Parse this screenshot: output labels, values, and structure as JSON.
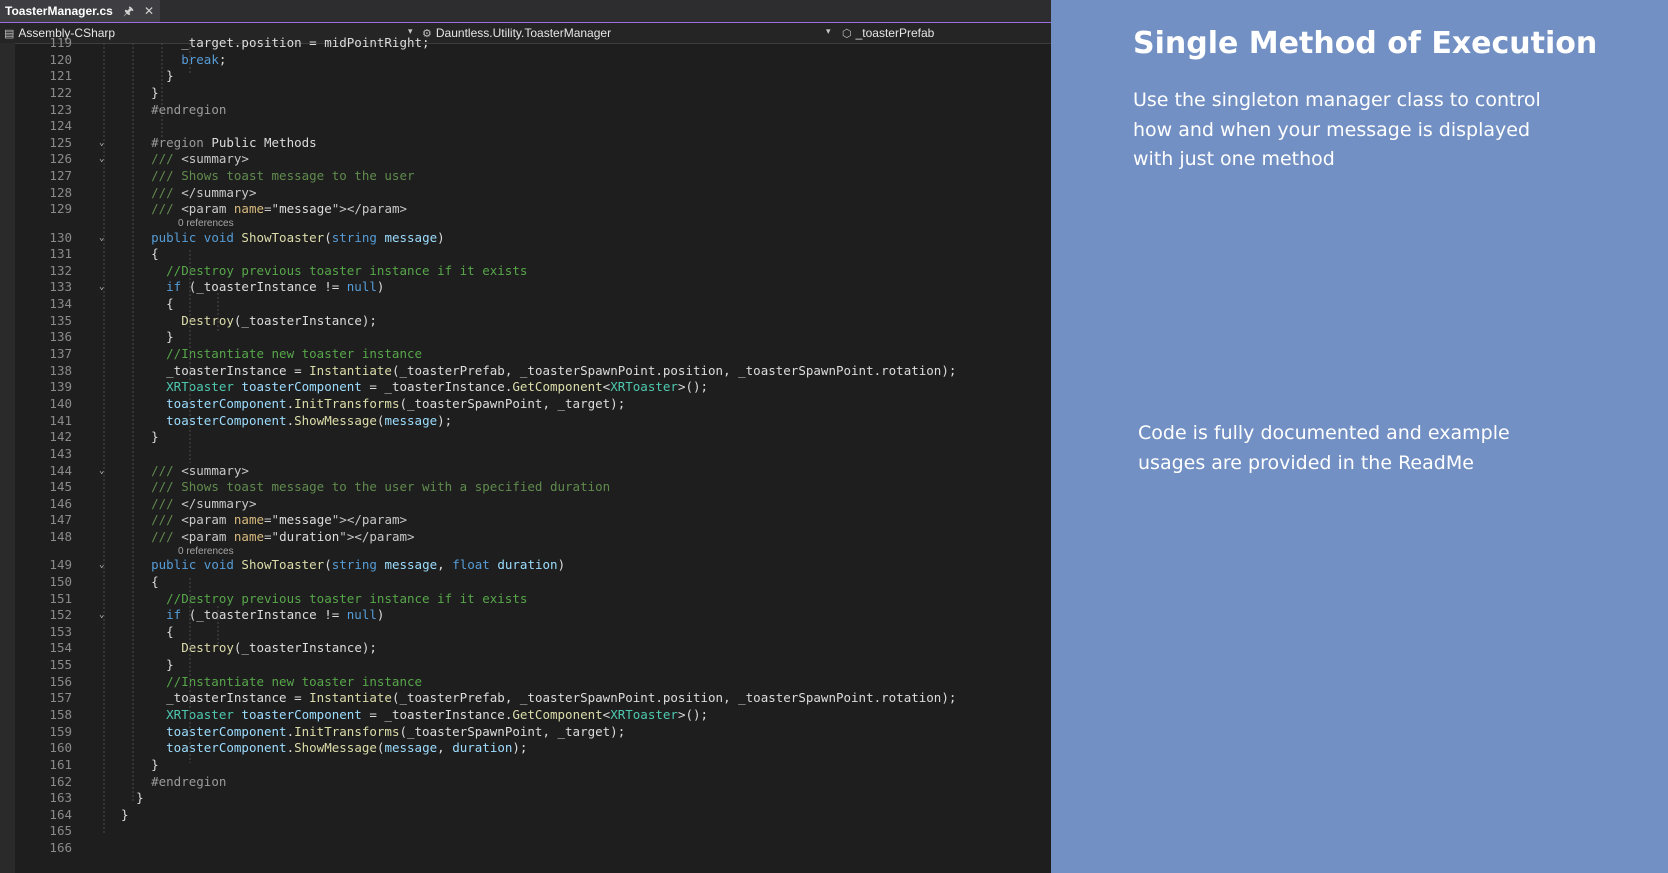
{
  "tab": {
    "title": "ToasterManager.cs",
    "pin_icon": "pin-icon",
    "close_icon": "close-icon"
  },
  "navbar": {
    "project": "Assembly-CSharp",
    "type": "Dauntless.Utility.ToasterManager",
    "member": "_toasterPrefab"
  },
  "code_lens_label": "0 references",
  "code_lines": [
    {
      "n": "119",
      "fold": false,
      "indent": 8,
      "s": [
        [
          "pl",
          "_target.position = midPointRight;"
        ]
      ]
    },
    {
      "n": "120",
      "fold": false,
      "indent": 8,
      "s": [
        [
          "kw",
          "break"
        ],
        [
          "pl",
          ";"
        ]
      ]
    },
    {
      "n": "121",
      "fold": false,
      "indent": 6,
      "s": [
        [
          "pl",
          "}"
        ]
      ]
    },
    {
      "n": "122",
      "fold": false,
      "indent": 4,
      "s": [
        [
          "pl",
          "}"
        ]
      ]
    },
    {
      "n": "123",
      "fold": false,
      "indent": 4,
      "s": [
        [
          "pp",
          "#endregion"
        ]
      ]
    },
    {
      "n": "124",
      "fold": false,
      "indent": 0,
      "s": []
    },
    {
      "n": "125",
      "fold": true,
      "indent": 4,
      "s": [
        [
          "pp",
          "#region "
        ],
        [
          "pl",
          "Public Methods"
        ]
      ]
    },
    {
      "n": "126",
      "fold": true,
      "indent": 4,
      "s": [
        [
          "xd",
          "/// "
        ],
        [
          "xa",
          "<summary>"
        ]
      ]
    },
    {
      "n": "127",
      "fold": false,
      "indent": 4,
      "s": [
        [
          "xd",
          "/// Shows toast message to the user"
        ]
      ]
    },
    {
      "n": "128",
      "fold": false,
      "indent": 4,
      "s": [
        [
          "xd",
          "/// "
        ],
        [
          "xa",
          "</summary>"
        ]
      ]
    },
    {
      "n": "129",
      "fold": false,
      "indent": 4,
      "s": [
        [
          "xd",
          "/// "
        ],
        [
          "xa",
          "<param "
        ],
        [
          "xs",
          "name"
        ],
        [
          "xa",
          "=\""
        ],
        [
          "pl",
          "message"
        ],
        [
          "xa",
          "\"></param>"
        ]
      ]
    },
    {
      "n": "",
      "lens": true
    },
    {
      "n": "130",
      "fold": true,
      "indent": 4,
      "s": [
        [
          "kw",
          "public void "
        ],
        [
          "fn",
          "ShowToaster"
        ],
        [
          "pl",
          "("
        ],
        [
          "kw",
          "string "
        ],
        [
          "pa",
          "message"
        ],
        [
          "pl",
          ")"
        ]
      ]
    },
    {
      "n": "131",
      "fold": false,
      "indent": 4,
      "s": [
        [
          "pl",
          "{"
        ]
      ]
    },
    {
      "n": "132",
      "fold": false,
      "indent": 6,
      "s": [
        [
          "cm",
          "//Destroy previous toaster instance if it exists"
        ]
      ]
    },
    {
      "n": "133",
      "fold": true,
      "indent": 6,
      "s": [
        [
          "kw",
          "if "
        ],
        [
          "pl",
          "(_toasterInstance != "
        ],
        [
          "kw",
          "null"
        ],
        [
          "pl",
          ")"
        ]
      ]
    },
    {
      "n": "134",
      "fold": false,
      "indent": 6,
      "s": [
        [
          "pl",
          "{"
        ]
      ]
    },
    {
      "n": "135",
      "fold": false,
      "indent": 8,
      "s": [
        [
          "fn",
          "Destroy"
        ],
        [
          "pl",
          "(_toasterInstance);"
        ]
      ]
    },
    {
      "n": "136",
      "fold": false,
      "indent": 6,
      "s": [
        [
          "pl",
          "}"
        ]
      ]
    },
    {
      "n": "137",
      "fold": false,
      "indent": 6,
      "s": [
        [
          "cm",
          "//Instantiate new toaster instance"
        ]
      ]
    },
    {
      "n": "138",
      "fold": false,
      "indent": 6,
      "s": [
        [
          "pl",
          "_toasterInstance = "
        ],
        [
          "fn",
          "Instantiate"
        ],
        [
          "pl",
          "(_toasterPrefab, _toasterSpawnPoint.position, _toasterSpawnPoint.rotation);"
        ]
      ]
    },
    {
      "n": "139",
      "fold": false,
      "indent": 6,
      "s": [
        [
          "ty",
          "XRToaster "
        ],
        [
          "pa",
          "toasterComponent"
        ],
        [
          "pl",
          " = _toasterInstance."
        ],
        [
          "fn",
          "GetComponent"
        ],
        [
          "pl",
          "<"
        ],
        [
          "ty",
          "XRToaster"
        ],
        [
          "pl",
          ">();"
        ]
      ]
    },
    {
      "n": "140",
      "fold": false,
      "indent": 6,
      "s": [
        [
          "pa",
          "toasterComponent"
        ],
        [
          "pl",
          "."
        ],
        [
          "fn",
          "InitTransforms"
        ],
        [
          "pl",
          "(_toasterSpawnPoint, _target);"
        ]
      ]
    },
    {
      "n": "141",
      "fold": false,
      "indent": 6,
      "s": [
        [
          "pa",
          "toasterComponent"
        ],
        [
          "pl",
          "."
        ],
        [
          "fn",
          "ShowMessage"
        ],
        [
          "pl",
          "("
        ],
        [
          "pa",
          "message"
        ],
        [
          "pl",
          ");"
        ]
      ]
    },
    {
      "n": "142",
      "fold": false,
      "indent": 4,
      "s": [
        [
          "pl",
          "}"
        ]
      ]
    },
    {
      "n": "143",
      "fold": false,
      "indent": 0,
      "s": []
    },
    {
      "n": "144",
      "fold": true,
      "indent": 4,
      "s": [
        [
          "xd",
          "/// "
        ],
        [
          "xa",
          "<summary>"
        ]
      ]
    },
    {
      "n": "145",
      "fold": false,
      "indent": 4,
      "s": [
        [
          "xd",
          "/// Shows toast message to the user with a specified duration"
        ]
      ]
    },
    {
      "n": "146",
      "fold": false,
      "indent": 4,
      "s": [
        [
          "xd",
          "/// "
        ],
        [
          "xa",
          "</summary>"
        ]
      ]
    },
    {
      "n": "147",
      "fold": false,
      "indent": 4,
      "s": [
        [
          "xd",
          "/// "
        ],
        [
          "xa",
          "<param "
        ],
        [
          "xs",
          "name"
        ],
        [
          "xa",
          "=\""
        ],
        [
          "pl",
          "message"
        ],
        [
          "xa",
          "\"></param>"
        ]
      ]
    },
    {
      "n": "148",
      "fold": false,
      "indent": 4,
      "s": [
        [
          "xd",
          "/// "
        ],
        [
          "xa",
          "<param "
        ],
        [
          "xs",
          "name"
        ],
        [
          "xa",
          "=\""
        ],
        [
          "pl",
          "duration"
        ],
        [
          "xa",
          "\"></param>"
        ]
      ]
    },
    {
      "n": "",
      "lens": true
    },
    {
      "n": "149",
      "fold": true,
      "indent": 4,
      "s": [
        [
          "kw",
          "public void "
        ],
        [
          "fn",
          "ShowToaster"
        ],
        [
          "pl",
          "("
        ],
        [
          "kw",
          "string "
        ],
        [
          "pa",
          "message"
        ],
        [
          "pl",
          ", "
        ],
        [
          "kw",
          "float "
        ],
        [
          "pa",
          "duration"
        ],
        [
          "pl",
          ")"
        ]
      ]
    },
    {
      "n": "150",
      "fold": false,
      "indent": 4,
      "s": [
        [
          "pl",
          "{"
        ]
      ]
    },
    {
      "n": "151",
      "fold": false,
      "indent": 6,
      "s": [
        [
          "cm",
          "//Destroy previous toaster instance if it exists"
        ]
      ]
    },
    {
      "n": "152",
      "fold": true,
      "indent": 6,
      "s": [
        [
          "kw",
          "if "
        ],
        [
          "pl",
          "(_toasterInstance != "
        ],
        [
          "kw",
          "null"
        ],
        [
          "pl",
          ")"
        ]
      ]
    },
    {
      "n": "153",
      "fold": false,
      "indent": 6,
      "s": [
        [
          "pl",
          "{"
        ]
      ]
    },
    {
      "n": "154",
      "fold": false,
      "indent": 8,
      "s": [
        [
          "fn",
          "Destroy"
        ],
        [
          "pl",
          "(_toasterInstance);"
        ]
      ]
    },
    {
      "n": "155",
      "fold": false,
      "indent": 6,
      "s": [
        [
          "pl",
          "}"
        ]
      ]
    },
    {
      "n": "156",
      "fold": false,
      "indent": 6,
      "s": [
        [
          "cm",
          "//Instantiate new toaster instance"
        ]
      ]
    },
    {
      "n": "157",
      "fold": false,
      "indent": 6,
      "s": [
        [
          "pl",
          "_toasterInstance = "
        ],
        [
          "fn",
          "Instantiate"
        ],
        [
          "pl",
          "(_toasterPrefab, _toasterSpawnPoint.position, _toasterSpawnPoint.rotation);"
        ]
      ]
    },
    {
      "n": "158",
      "fold": false,
      "indent": 6,
      "s": [
        [
          "ty",
          "XRToaster "
        ],
        [
          "pa",
          "toasterComponent"
        ],
        [
          "pl",
          " = _toasterInstance."
        ],
        [
          "fn",
          "GetComponent"
        ],
        [
          "pl",
          "<"
        ],
        [
          "ty",
          "XRToaster"
        ],
        [
          "pl",
          ">();"
        ]
      ]
    },
    {
      "n": "159",
      "fold": false,
      "indent": 6,
      "s": [
        [
          "pa",
          "toasterComponent"
        ],
        [
          "pl",
          "."
        ],
        [
          "fn",
          "InitTransforms"
        ],
        [
          "pl",
          "(_toasterSpawnPoint, _target);"
        ]
      ]
    },
    {
      "n": "160",
      "fold": false,
      "indent": 6,
      "s": [
        [
          "pa",
          "toasterComponent"
        ],
        [
          "pl",
          "."
        ],
        [
          "fn",
          "ShowMessage"
        ],
        [
          "pl",
          "("
        ],
        [
          "pa",
          "message"
        ],
        [
          "pl",
          ", "
        ],
        [
          "pa",
          "duration"
        ],
        [
          "pl",
          ");"
        ]
      ]
    },
    {
      "n": "161",
      "fold": false,
      "indent": 4,
      "s": [
        [
          "pl",
          "}"
        ]
      ]
    },
    {
      "n": "162",
      "fold": false,
      "indent": 4,
      "s": [
        [
          "pp",
          "#endregion"
        ]
      ]
    },
    {
      "n": "163",
      "fold": false,
      "indent": 2,
      "s": [
        [
          "pl",
          "}"
        ]
      ]
    },
    {
      "n": "164",
      "fold": false,
      "indent": 0,
      "s": [
        [
          "pl",
          "}"
        ]
      ]
    },
    {
      "n": "165",
      "fold": false,
      "indent": 0,
      "s": []
    },
    {
      "n": "166",
      "fold": false,
      "indent": 0,
      "s": []
    }
  ],
  "panel": {
    "title": "Single Method of Execution",
    "description": "Use the singleton manager class to control how and when your message is displayed with just one method",
    "note": "Code is fully documented and example usages are provided in the ReadMe"
  },
  "colors": {
    "editor_bg": "#1e1e1e",
    "panel_bg": "#7290c3",
    "tab_accent": "#9b6fe0",
    "keyword": "#569cd6",
    "comment": "#57a64a",
    "type": "#4ec9b0",
    "method": "#dcdcaa",
    "parameter": "#9cdcfe"
  }
}
